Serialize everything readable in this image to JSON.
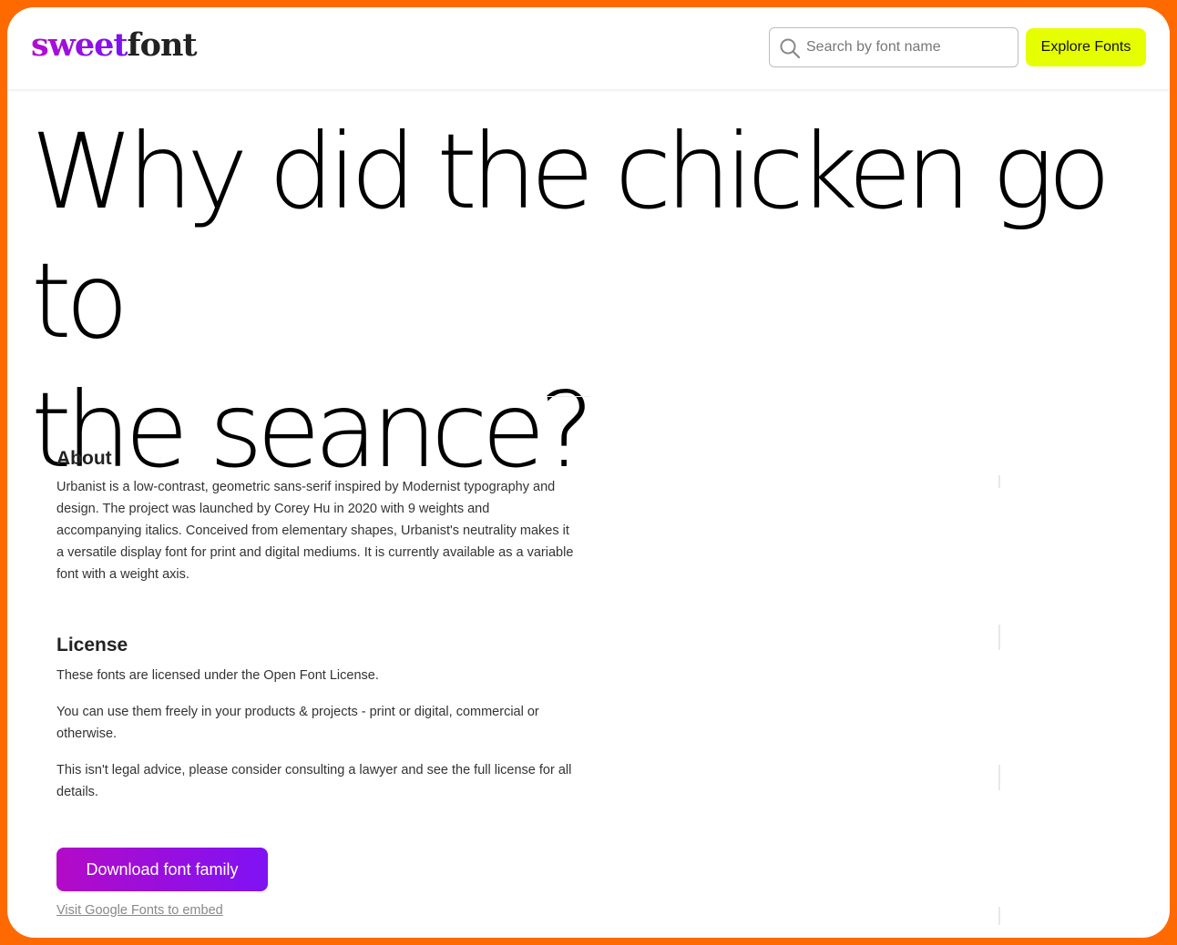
{
  "brand": {
    "part1": "sweet",
    "part2": "font"
  },
  "search": {
    "placeholder": "Search by font name",
    "value": ""
  },
  "nav": {
    "explore_label": "Explore Fonts"
  },
  "preview": {
    "line1": "Why did the chicken go to",
    "line2": "the seance?"
  },
  "about": {
    "title": "About",
    "text": "Urbanist is a low-contrast, geometric sans-serif inspired by Modernist typography and design. The project was launched by Corey Hu in 2020 with 9 weights and accompanying italics. Conceived from elementary shapes, Urbanist's neutrality makes it a versatile display font for print and digital mediums. It is currently available as a variable font with a weight axis."
  },
  "license": {
    "title": "License",
    "p1": "These fonts are licensed under the Open Font License.",
    "p2": "You can use them freely in your products & projects - print or digital, commercial or otherwise.",
    "p3": "This isn't legal advice, please consider consulting a lawyer and see the full license for all details."
  },
  "actions": {
    "download_label": "Download font family",
    "google_fonts_link": "Visit Google Fonts to embed"
  },
  "colors": {
    "frame": "#ff6a00",
    "explore_button": "#e6ff00",
    "brand_gradient_start": "#b10fd0",
    "brand_gradient_end": "#7a12f2"
  },
  "icons": {
    "search": "search-icon"
  }
}
